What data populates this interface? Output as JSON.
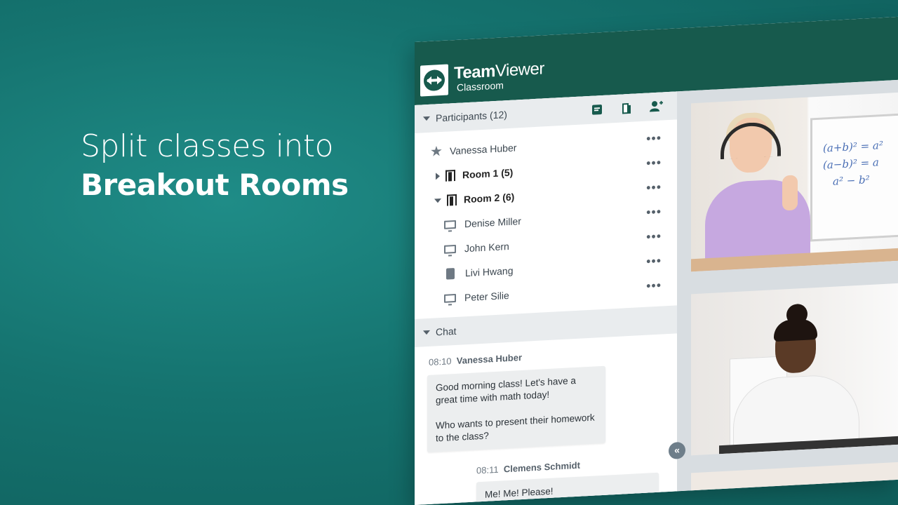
{
  "headline": {
    "line1": "Split classes into",
    "line2": "Breakout Rooms"
  },
  "app": {
    "brand_bold": "Team",
    "brand_light": "Viewer",
    "product": "Classroom"
  },
  "participants": {
    "header": "Participants (12)",
    "icons": [
      "notes-icon",
      "breakout-door-icon",
      "add-user-icon"
    ],
    "rows": [
      {
        "label": "Vanessa Huber",
        "icon": "star-icon",
        "more": "•••"
      },
      {
        "label": "Room 1 (5)",
        "icon": "door-icon",
        "more": "•••",
        "expanded": false
      },
      {
        "label": "Room 2 (6)",
        "icon": "door-icon",
        "more": "•••",
        "expanded": true
      },
      {
        "label": "Denise Miller",
        "icon": "monitor-icon",
        "more": "•••"
      },
      {
        "label": "John Kern",
        "icon": "monitor-icon",
        "more": "•••"
      },
      {
        "label": "Livi Hwang",
        "icon": "tablet-icon",
        "more": "•••"
      },
      {
        "label": "Peter Silie",
        "icon": "monitor-icon",
        "more": "•••"
      }
    ]
  },
  "chat": {
    "header": "Chat",
    "messages": [
      {
        "time": "08:10",
        "sender": "Vanessa Huber",
        "line1": "Good morning class! Let's have a",
        "line2": "great time with math today!",
        "line3": "Who wants to present their homework",
        "line4": "to the class?"
      },
      {
        "time": "08:11",
        "sender": "Clemens Schmidt",
        "line1": "Me! Me! Please!"
      }
    ],
    "collapse_glyph": "«"
  },
  "video": {
    "formula1": "(a+b)² = a²",
    "formula2": "(a−b)² = a",
    "formula3": "a² − b²"
  },
  "colors": {
    "brand_green": "#175a4d",
    "background_teal": "#15736f"
  }
}
